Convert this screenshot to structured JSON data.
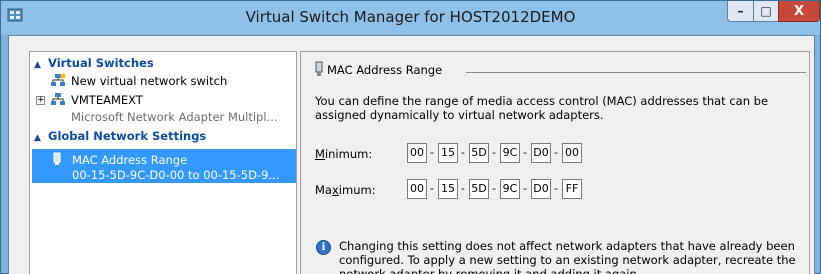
{
  "window": {
    "title": "Virtual Switch Manager for HOST2012DEMO",
    "buttons": {
      "minimize": "–",
      "maximize": "□",
      "close": "X"
    }
  },
  "sidebar": {
    "sections": [
      {
        "label": "Virtual Switches",
        "items": [
          {
            "label": "New virtual network switch",
            "sublabel": "",
            "icon": "new-switch-icon",
            "expandable": false,
            "selected": false
          },
          {
            "label": "VMTEAMEXT",
            "sublabel": "Microsoft Network Adapter Multipl...",
            "icon": "network-switch-icon",
            "expandable": true,
            "selected": false
          }
        ]
      },
      {
        "label": "Global Network Settings",
        "items": [
          {
            "label": "MAC Address Range",
            "sublabel": "00-15-5D-9C-D0-00 to 00-15-5D-9...",
            "icon": "mac-adapter-icon",
            "expandable": false,
            "selected": true
          }
        ]
      }
    ]
  },
  "main": {
    "group_title": "MAC Address Range",
    "description": "You can define the range of media access control (MAC) addresses that can be assigned dynamically to virtual network adapters.",
    "minimum": {
      "label_first": "M",
      "label_rest": "inimum:",
      "octets": [
        "00",
        "15",
        "5D",
        "9C",
        "D0",
        "00"
      ]
    },
    "maximum": {
      "label_first": "Ma",
      "label_under": "x",
      "label_rest": "imum:",
      "octets": [
        "00",
        "15",
        "5D",
        "9C",
        "D0",
        "FF"
      ]
    },
    "separator": "-",
    "info_glyph": "i",
    "note": "Changing this setting does not affect network adapters that have already been configured.  To apply a new setting to an existing network adapter, recreate the network adapter by removing it and adding it again."
  },
  "colors": {
    "selection": "#3399ff",
    "category_text": "#0b4ea2",
    "close_button": "#c7483a",
    "frame": "#7fb3df"
  }
}
